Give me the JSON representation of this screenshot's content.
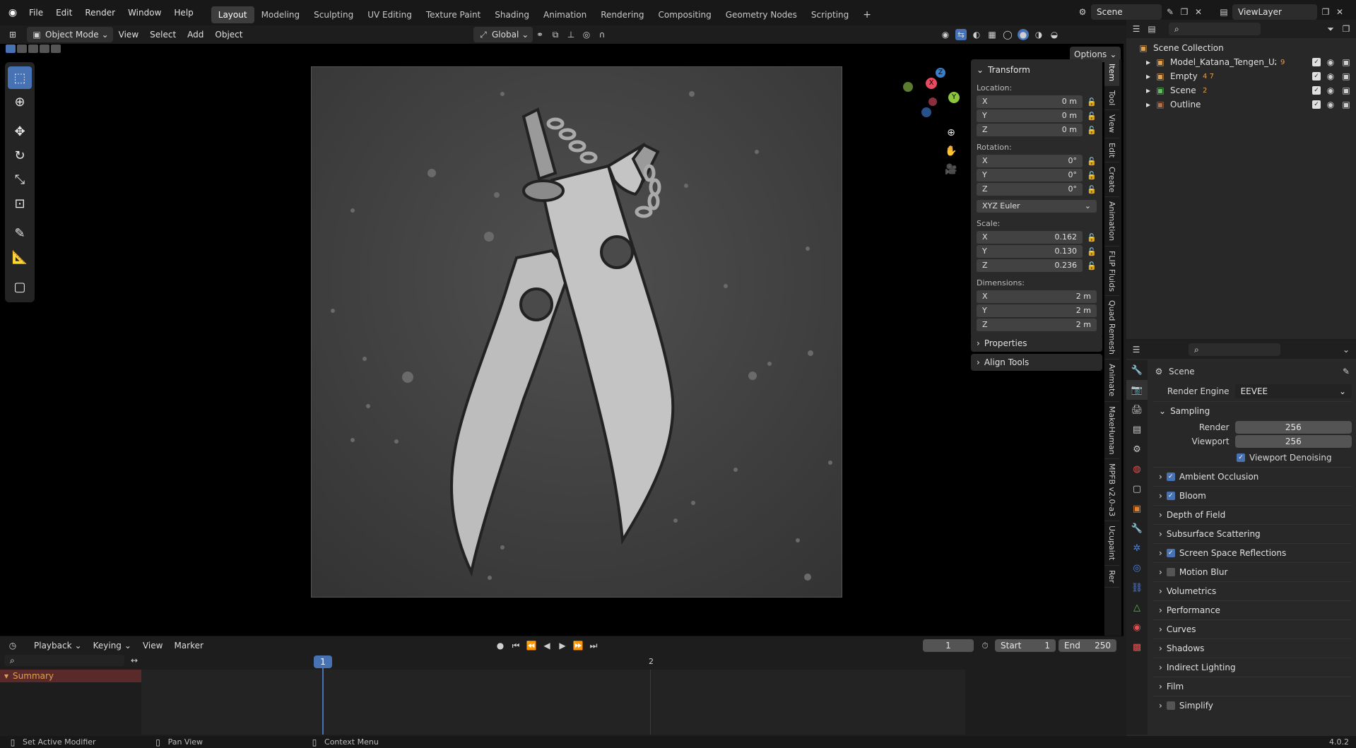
{
  "topbar": {
    "menus": [
      "File",
      "Edit",
      "Render",
      "Window",
      "Help"
    ],
    "workspaces": [
      "Layout",
      "Modeling",
      "Sculpting",
      "UV Editing",
      "Texture Paint",
      "Shading",
      "Animation",
      "Rendering",
      "Compositing",
      "Geometry Nodes",
      "Scripting"
    ],
    "active_workspace": "Layout",
    "scene": "Scene",
    "view_layer": "ViewLayer"
  },
  "header": {
    "mode": "Object Mode",
    "menus": [
      "View",
      "Select",
      "Add",
      "Object"
    ],
    "orientation": "Global",
    "options": "Options"
  },
  "npanel": {
    "transform": "Transform",
    "location_label": "Location:",
    "location": [
      {
        "axis": "X",
        "value": "0 m"
      },
      {
        "axis": "Y",
        "value": "0 m"
      },
      {
        "axis": "Z",
        "value": "0 m"
      }
    ],
    "rotation_label": "Rotation:",
    "rotation": [
      {
        "axis": "X",
        "value": "0°"
      },
      {
        "axis": "Y",
        "value": "0°"
      },
      {
        "axis": "Z",
        "value": "0°"
      }
    ],
    "rotation_mode": "XYZ Euler",
    "scale_label": "Scale:",
    "scale": [
      {
        "axis": "X",
        "value": "0.162"
      },
      {
        "axis": "Y",
        "value": "0.130"
      },
      {
        "axis": "Z",
        "value": "0.236"
      }
    ],
    "dimensions_label": "Dimensions:",
    "dimensions": [
      {
        "axis": "X",
        "value": "2 m"
      },
      {
        "axis": "Y",
        "value": "2 m"
      },
      {
        "axis": "Z",
        "value": "2 m"
      }
    ],
    "properties": "Properties",
    "align_tools": "Align Tools"
  },
  "sidebar_tabs": [
    "Item",
    "Tool",
    "View",
    "Edit",
    "Create",
    "Animation",
    "FLIP Fluids",
    "Quad Remesh",
    "Animate",
    "MakeHuman",
    "MPFB v2.0-a3",
    "Ucupaint",
    "Rer"
  ],
  "outliner": {
    "root": "Scene Collection",
    "items": [
      {
        "name": "Model_Katana_Tengen_Uzui",
        "badge": "9"
      },
      {
        "name": "Empty",
        "badge": "4 7"
      },
      {
        "name": "Scene",
        "badge": "2"
      },
      {
        "name": "Outline",
        "badge": ""
      }
    ]
  },
  "properties": {
    "context": "Scene",
    "render_engine_label": "Render Engine",
    "render_engine": "EEVEE",
    "sampling": "Sampling",
    "render_label": "Render",
    "render_value": "256",
    "viewport_label": "Viewport",
    "viewport_value": "256",
    "denoise": "Viewport Denoising",
    "sections": [
      {
        "name": "Ambient Occlusion",
        "check": "on"
      },
      {
        "name": "Bloom",
        "check": "on"
      },
      {
        "name": "Depth of Field",
        "check": "none"
      },
      {
        "name": "Subsurface Scattering",
        "check": "none"
      },
      {
        "name": "Screen Space Reflections",
        "check": "on"
      },
      {
        "name": "Motion Blur",
        "check": "off"
      },
      {
        "name": "Volumetrics",
        "check": "none"
      },
      {
        "name": "Performance",
        "check": "none"
      },
      {
        "name": "Curves",
        "check": "none"
      },
      {
        "name": "Shadows",
        "check": "none"
      },
      {
        "name": "Indirect Lighting",
        "check": "none"
      },
      {
        "name": "Film",
        "check": "none"
      },
      {
        "name": "Simplify",
        "check": "off"
      }
    ]
  },
  "timeline": {
    "menus": [
      "Playback",
      "Keying",
      "View",
      "Marker"
    ],
    "current_frame": "1",
    "start_label": "Start",
    "start": "1",
    "end_label": "End",
    "end": "250",
    "summary": "Summary",
    "marker_1": "1",
    "marker_2": "2"
  },
  "status": {
    "left": "Set Active Modifier",
    "middle": "Pan View",
    "right": "Context Menu",
    "version": "4.0.2"
  },
  "colors": {
    "accent": "#4772b3",
    "axis_x": "#e84a5f",
    "axis_y": "#8cc63f",
    "axis_z": "#3a7ecb"
  }
}
